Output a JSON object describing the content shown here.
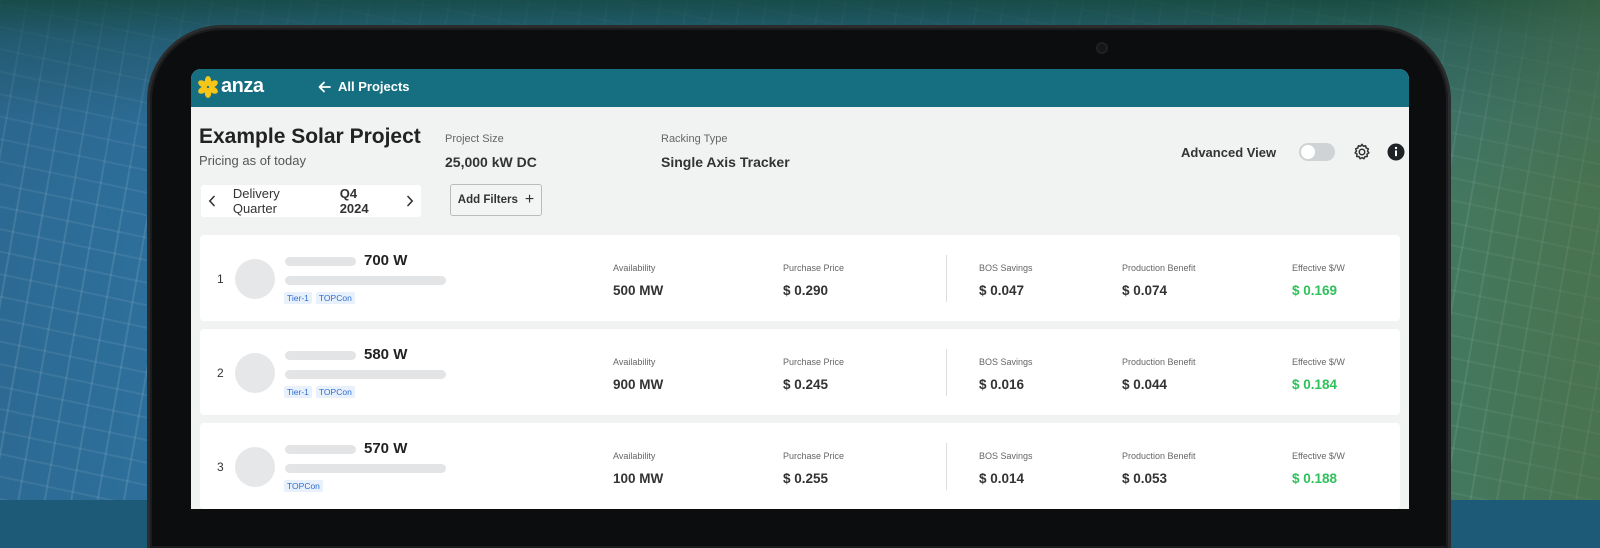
{
  "app": {
    "logo_text": "anza",
    "accent_color": "#156f80",
    "logo_color": "#f5c518"
  },
  "nav": {
    "back_label": "All Projects"
  },
  "project": {
    "title": "Example Solar Project",
    "subtitle": "Pricing as of today",
    "size_label": "Project Size",
    "size_value": "25,000 kW DC",
    "racking_label": "Racking Type",
    "racking_value": "Single Axis Tracker"
  },
  "quarter": {
    "label": "Delivery Quarter",
    "value": "Q4 2024"
  },
  "filters": {
    "label": "Add Filters"
  },
  "advanced_view": {
    "label": "Advanced View",
    "enabled": false
  },
  "columns": {
    "availability": "Availability",
    "purchase_price": "Purchase Price",
    "bos_savings": "BOS Savings",
    "production_benefit": "Production Benefit",
    "effective": "Effective $/W"
  },
  "rows": [
    {
      "rank": "1",
      "wattage": "700 W",
      "tags": [
        "Tier-1",
        "TOPCon"
      ],
      "availability": "500 MW",
      "purchase_price": "$ 0.290",
      "bos_savings": "$ 0.047",
      "production_benefit": "$ 0.074",
      "effective": "$ 0.169"
    },
    {
      "rank": "2",
      "wattage": "580 W",
      "tags": [
        "Tier-1",
        "TOPCon"
      ],
      "availability": "900 MW",
      "purchase_price": "$ 0.245",
      "bos_savings": "$ 0.016",
      "production_benefit": "$ 0.044",
      "effective": "$ 0.184"
    },
    {
      "rank": "3",
      "wattage": "570 W",
      "tags": [
        "TOPCon"
      ],
      "availability": "100 MW",
      "purchase_price": "$ 0.255",
      "bos_savings": "$ 0.014",
      "production_benefit": "$ 0.053",
      "effective": "$ 0.188"
    }
  ],
  "icons": {
    "back": "arrow-left-icon",
    "prev": "chevron-left-icon",
    "next": "chevron-right-icon",
    "add": "plus-icon",
    "settings": "gear-icon",
    "info": "info-icon"
  }
}
